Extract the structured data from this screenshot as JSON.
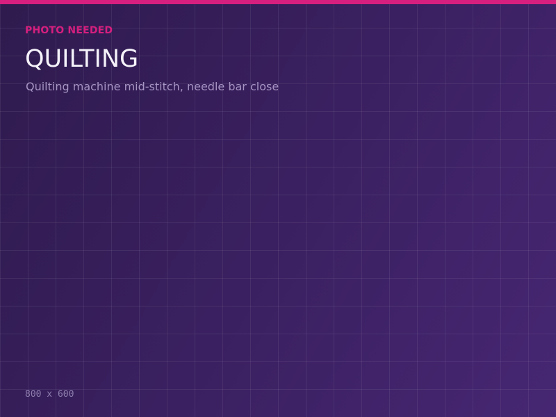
{
  "placeholder": {
    "label": "PHOTO NEEDED",
    "title": "QUILTING",
    "description": "Quilting machine mid-stitch, needle bar close",
    "dimensions": "800 x 600"
  },
  "colors": {
    "accent": "#d61f7f",
    "background_start": "#2f1b4e",
    "background_end": "#462672",
    "title": "#f5f2fa",
    "subtitle": "#a795c4"
  }
}
